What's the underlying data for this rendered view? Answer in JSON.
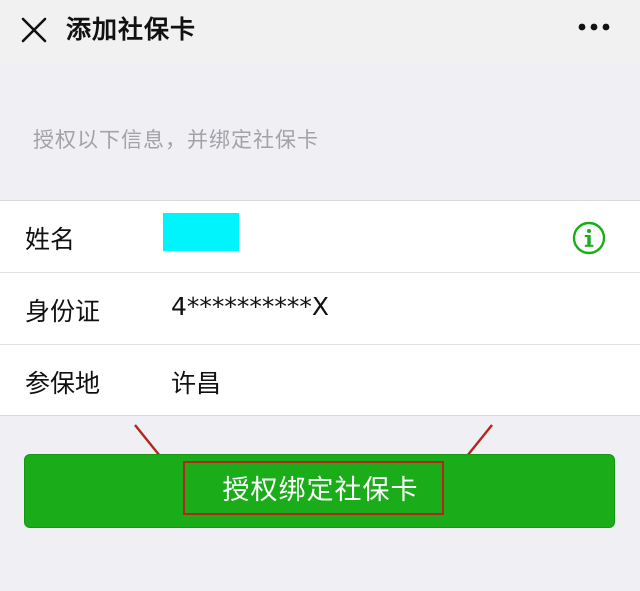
{
  "header": {
    "title": "添加社保卡",
    "close_icon": "close-icon",
    "more_icon": "more-dots-icon"
  },
  "intro": {
    "text": "授权以下信息，并绑定社保卡"
  },
  "fields": [
    {
      "label": "姓名",
      "value": ""
    },
    {
      "label": "身份证",
      "value": "4**********X"
    },
    {
      "label": "参保地",
      "value": "许昌"
    }
  ],
  "actions": {
    "bind_label": "授权绑定社保卡"
  },
  "colors": {
    "accent": "#1aad19",
    "highlight": "#b3261e",
    "redaction": "#00f4fb",
    "background": "#efeff4"
  }
}
